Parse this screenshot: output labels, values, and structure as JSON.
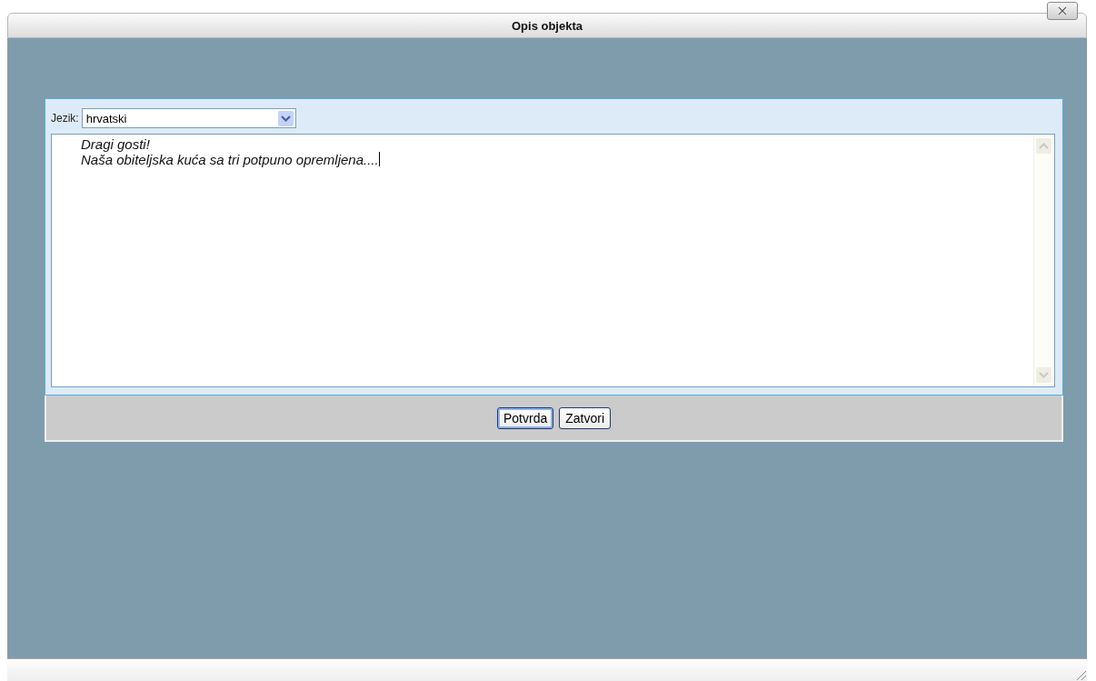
{
  "window": {
    "title": "Opis objekta"
  },
  "language": {
    "label": "Jezik:",
    "value": "hrvatski"
  },
  "description": {
    "value": "Dragi gosti!\nNaša obiteljska kuća sa tri potpuno opremljena...."
  },
  "buttons": [
    {
      "label": "Potvrda",
      "selected": true
    },
    {
      "label": "Zatvori",
      "selected": false
    }
  ]
}
